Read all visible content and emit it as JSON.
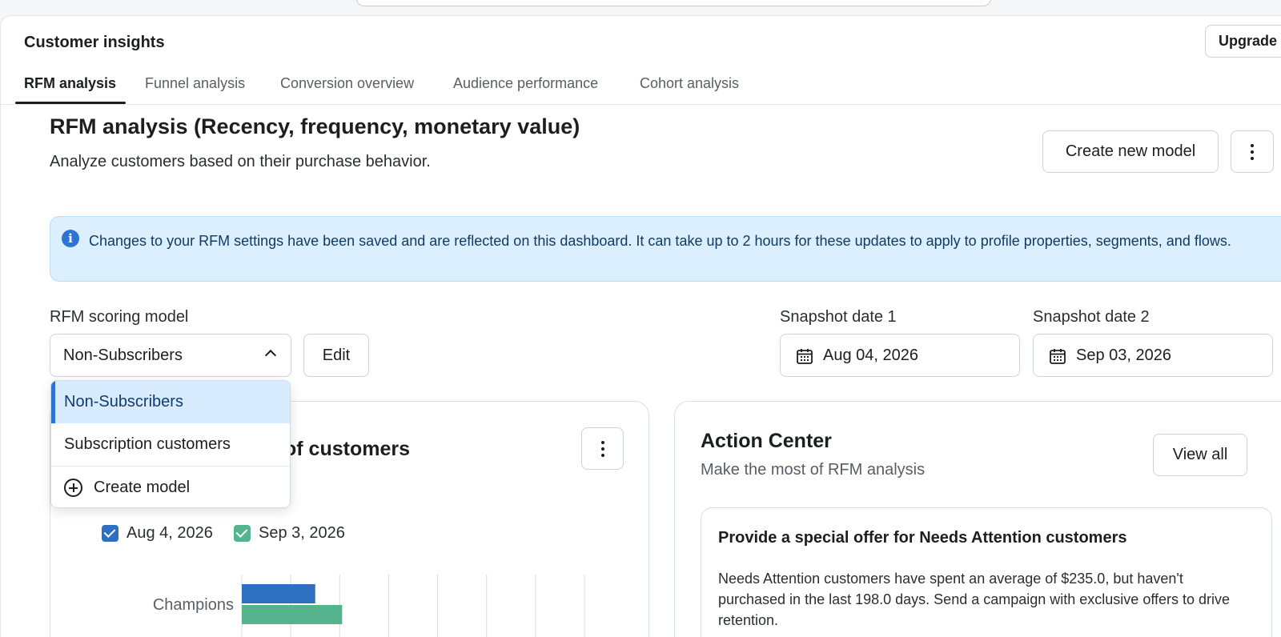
{
  "app": {
    "title": "Customer insights",
    "upgrade_label": "Upgrade"
  },
  "tabs": [
    {
      "label": "RFM analysis"
    },
    {
      "label": "Funnel analysis"
    },
    {
      "label": "Conversion overview"
    },
    {
      "label": "Audience performance"
    },
    {
      "label": "Cohort analysis"
    }
  ],
  "header": {
    "title": "RFM analysis (Recency, frequency, monetary value)",
    "subtitle": "Analyze customers based on their purchase behavior.",
    "create_button": "Create new model"
  },
  "alert": {
    "text": "Changes to your RFM settings have been saved and are reflected on this dashboard. It can take up to 2 hours for these updates to apply to profile properties, segments, and flows.",
    "icon": "i"
  },
  "scoring": {
    "label": "RFM scoring model",
    "selected": "Non-Subscribers",
    "edit_label": "Edit",
    "options": [
      {
        "label": "Non-Subscribers"
      },
      {
        "label": "Subscription customers"
      }
    ],
    "create_label": "Create model"
  },
  "snapshots": {
    "date1_label": "Snapshot date 1",
    "date1_value": "Aug 04, 2026",
    "date2_label": "Snapshot date 2",
    "date2_value": "Sep 03, 2026"
  },
  "chart_card": {
    "title_visible": "of customers",
    "legend": [
      {
        "label": "Aug 4, 2026",
        "color": "#2f6fc1"
      },
      {
        "label": "Sep 3, 2026",
        "color": "#55b48d"
      }
    ]
  },
  "chart_data": {
    "type": "bar",
    "orientation": "horizontal",
    "categories": [
      "Champions"
    ],
    "series": [
      {
        "name": "Aug 4, 2026",
        "values": [
          1.5
        ]
      },
      {
        "name": "Sep 3, 2026",
        "values": [
          2.05
        ]
      }
    ],
    "xlim": [
      0,
      7
    ],
    "grid": true
  },
  "action_center": {
    "title": "Action Center",
    "subtitle": "Make the most of RFM analysis",
    "view_all": "View all",
    "offer_title": "Provide a special offer for Needs Attention customers",
    "offer_body": "Needs Attention customers have spent an average of $235.0, but haven't purchased in the last 198.0 days. Send a campaign with exclusive offers to drive retention."
  },
  "colors": {
    "accent": "#2c73d2",
    "alert_bg": "#dcefff",
    "series1": "#2f6fc1",
    "series2": "#55b48d"
  }
}
